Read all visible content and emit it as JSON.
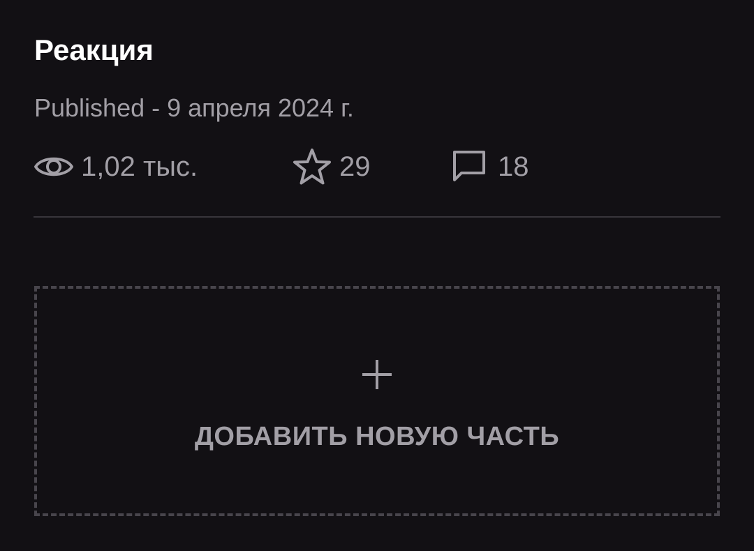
{
  "part": {
    "title": "Реакция",
    "published": "Published - 9 апреля 2024 г."
  },
  "stats": {
    "views": {
      "icon": "eye-icon",
      "value": "1,02 тыс."
    },
    "votes": {
      "icon": "star-icon",
      "value": "29"
    },
    "comments": {
      "icon": "comment-icon",
      "value": "18"
    }
  },
  "add_part": {
    "icon": "plus-icon",
    "label": "ДОБАВИТЬ НОВУЮ ЧАСТЬ"
  },
  "colors": {
    "background": "#121014",
    "muted_text": "#a29fa6",
    "divider": "#38353b",
    "dashed_border": "#48454c"
  }
}
